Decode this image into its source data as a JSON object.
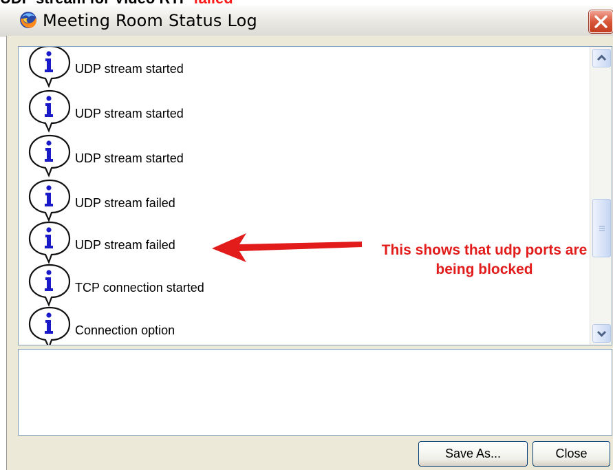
{
  "caption": {
    "prefix": "UDP stream for Video RTP ",
    "status": "failed"
  },
  "window": {
    "title": "Meeting Room Status Log",
    "app_icon": "firefox-icon",
    "close_icon": "close-icon"
  },
  "log": {
    "entries": [
      {
        "icon": "info-icon",
        "text": "UDP stream started"
      },
      {
        "icon": "info-icon",
        "text": "UDP stream started"
      },
      {
        "icon": "info-icon",
        "text": "UDP stream started"
      },
      {
        "icon": "info-icon",
        "text": "UDP stream failed"
      },
      {
        "icon": "info-icon",
        "text": "UDP stream failed"
      },
      {
        "icon": "info-icon",
        "text": "TCP connection started"
      },
      {
        "icon": "info-icon",
        "text": "Connection option"
      }
    ]
  },
  "detail": {
    "text": ""
  },
  "buttons": {
    "save_as": "Save As...",
    "close": "Close"
  },
  "annotation": {
    "line1": "This shows that udp ports are",
    "line2": "being blocked",
    "color": "#e21b1b"
  },
  "colors": {
    "accent_border": "#7f9db9",
    "dialog_bg": "#ece9d8",
    "close_red": "#d8583a",
    "info_blue": "#1a1ac8"
  }
}
